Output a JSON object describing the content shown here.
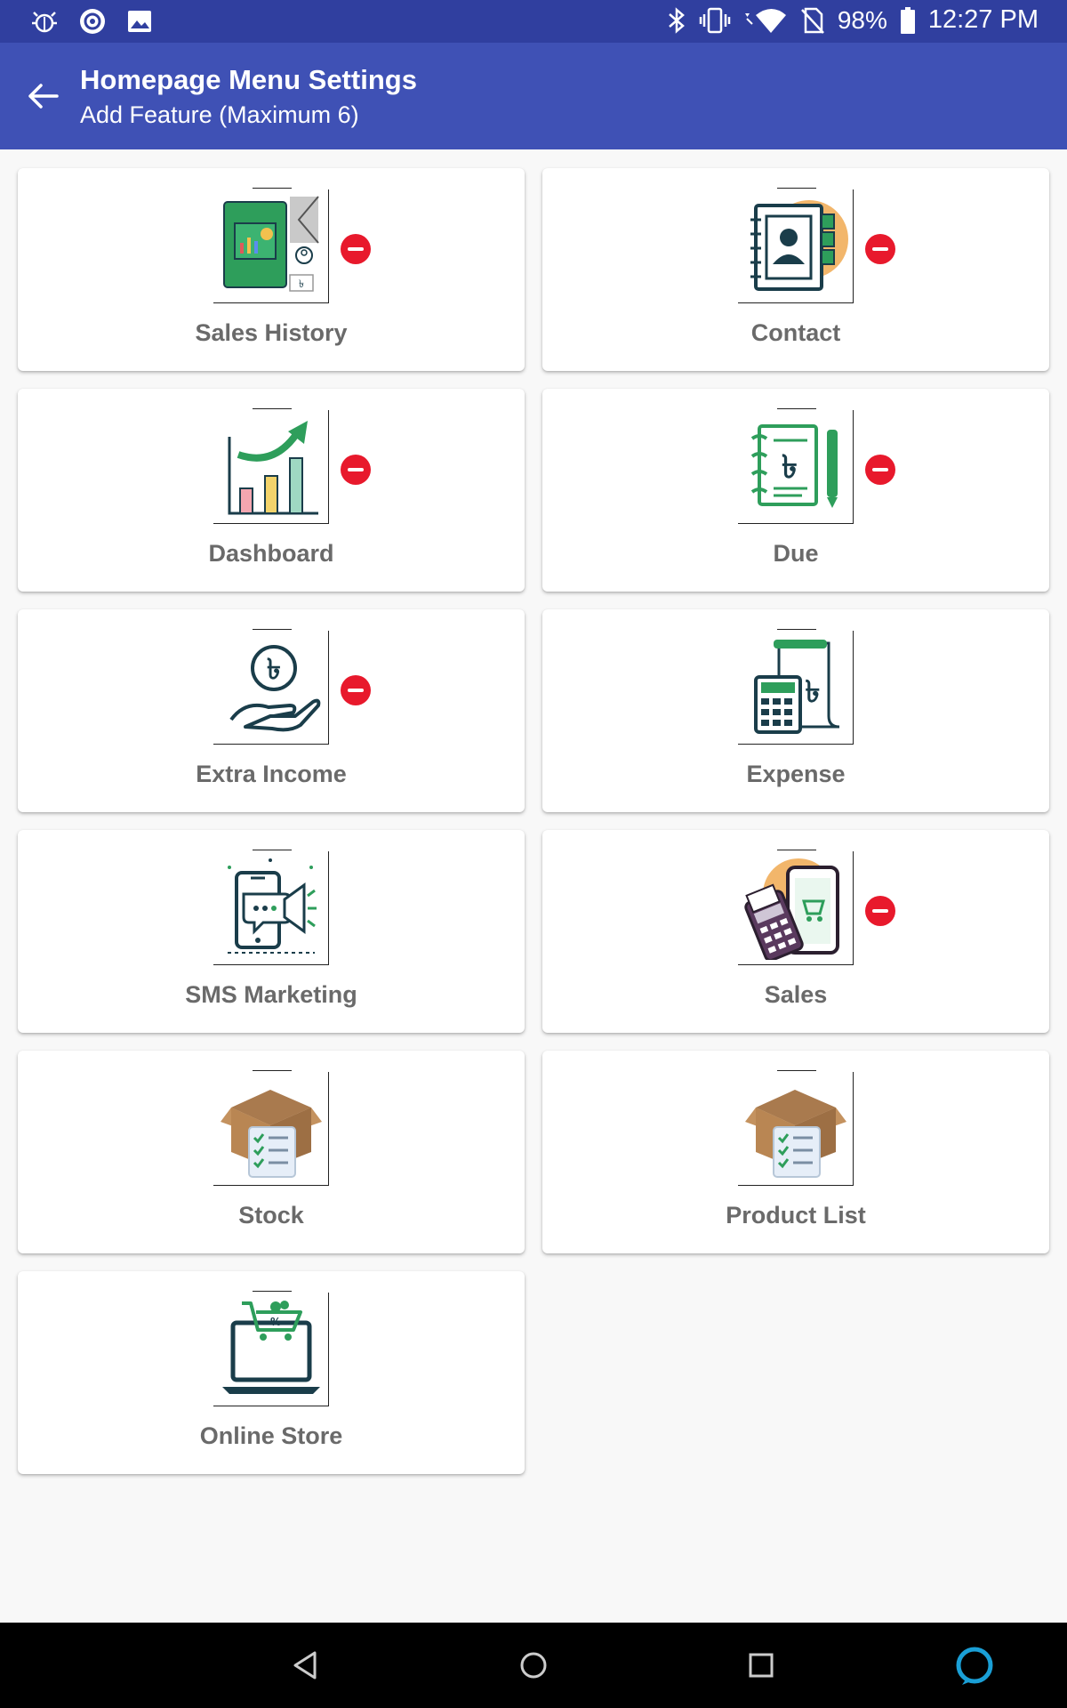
{
  "status_bar": {
    "battery": "98%",
    "time": "12:27 PM",
    "icons": [
      "bug-icon",
      "tracker-icon",
      "image-icon",
      "bluetooth-icon",
      "vibrate-icon",
      "wifi-icon",
      "no-sim-icon",
      "battery-icon"
    ]
  },
  "header": {
    "title": "Homepage Menu Settings",
    "subtitle": "Add Feature (Maximum 6)",
    "back_icon": "arrow-back-icon"
  },
  "features": [
    {
      "label": "Sales History",
      "icon": "sales-history-icon",
      "selected": true
    },
    {
      "label": "Contact",
      "icon": "contact-book-icon",
      "selected": true
    },
    {
      "label": "Dashboard",
      "icon": "dashboard-chart-icon",
      "selected": true
    },
    {
      "label": "Due",
      "icon": "due-ledger-icon",
      "selected": true
    },
    {
      "label": "Extra Income",
      "icon": "extra-income-icon",
      "selected": true
    },
    {
      "label": "Expense",
      "icon": "expense-calculator-icon",
      "selected": false
    },
    {
      "label": "SMS Marketing",
      "icon": "sms-marketing-icon",
      "selected": false
    },
    {
      "label": "Sales",
      "icon": "sales-pos-icon",
      "selected": true
    },
    {
      "label": "Stock",
      "icon": "stock-box-icon",
      "selected": false
    },
    {
      "label": "Product List",
      "icon": "product-list-box-icon",
      "selected": false
    },
    {
      "label": "Online Store",
      "icon": "online-store-icon",
      "selected": false
    }
  ],
  "nav": {
    "back": "nav-back-icon",
    "home": "nav-home-icon",
    "recents": "nav-recents-icon",
    "assistant": "alexa-icon"
  },
  "colors": {
    "status_bar": "#303f9f",
    "app_bar": "#3f51b5",
    "remove": "#e8192c",
    "label": "#6a6a6a",
    "accent_green": "#2e9e5b",
    "accent_dark": "#1a3d4a"
  }
}
